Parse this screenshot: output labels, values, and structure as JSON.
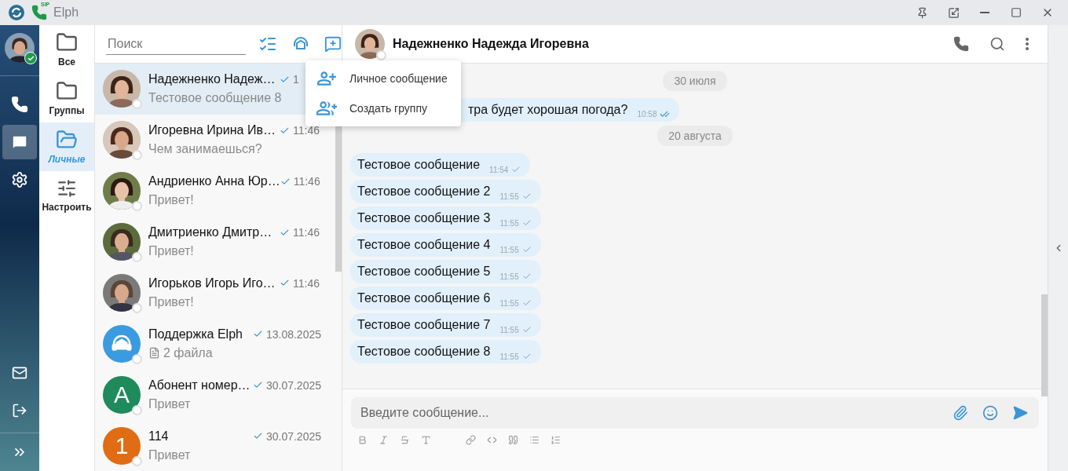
{
  "titlebar": {
    "app_name": "Elph",
    "sip_badge": "SIP"
  },
  "rail": {
    "user_online": true,
    "items": [
      {
        "kind": "phone",
        "selected": false
      },
      {
        "kind": "chat",
        "selected": true
      },
      {
        "kind": "settings",
        "selected": false
      }
    ],
    "bottom": [
      {
        "kind": "mail"
      },
      {
        "kind": "logout"
      },
      {
        "kind": "expand"
      }
    ]
  },
  "folders": [
    {
      "kind": "folder",
      "label": "Все",
      "selected": false
    },
    {
      "kind": "folder",
      "label": "Группы",
      "selected": false
    },
    {
      "kind": "folder",
      "label": "Личные",
      "selected": true
    },
    {
      "kind": "settings",
      "label": "Настроить",
      "selected": false
    }
  ],
  "search": {
    "placeholder": "Поиск"
  },
  "new_chat_menu": [
    {
      "kind": "person",
      "label": "Личное сообщение"
    },
    {
      "kind": "group",
      "label": "Создать группу"
    }
  ],
  "chats": [
    {
      "name": "Надежненко Надеж…",
      "time": "1",
      "preview": "Тестовое сообщение 8",
      "attachment": false,
      "selected": true
    },
    {
      "name": "Игоревна Ирина Ив…",
      "time": "11:46",
      "preview": "Чем занимаешься?",
      "attachment": false,
      "selected": false
    },
    {
      "name": "Андриенко Анна Юр…",
      "time": "11:46",
      "preview": "Привет!",
      "attachment": false,
      "selected": false
    },
    {
      "name": "Дмитриенко Дмитр…",
      "time": "11:46",
      "preview": "Привет!",
      "attachment": false,
      "selected": false
    },
    {
      "name": "Игорьков Игорь Иго…",
      "time": "11:46",
      "preview": "Привет!",
      "attachment": false,
      "selected": false
    },
    {
      "kind": "support",
      "name": "Поддержка Elph",
      "time": "13.08.2025",
      "preview": "2 файла",
      "attachment": true,
      "selected": false
    },
    {
      "kind": "letter",
      "letter": "A",
      "color": "#1f8a5b",
      "name": "Абонент номер…",
      "time": "30.07.2025",
      "preview": "Привет",
      "attachment": false,
      "selected": false
    },
    {
      "kind": "letter",
      "letter": "1",
      "color": "#e06c14",
      "name": "114",
      "time": "30.07.2025",
      "preview": "Привет",
      "attachment": false,
      "selected": false
    }
  ],
  "conversation": {
    "title": "Надежненко Надежда Игоревна",
    "messages": [
      {
        "kind": "date",
        "text": "30 июля"
      },
      {
        "kind": "message",
        "text": "тра будет хорошая погода?",
        "time": "10:58",
        "read": true,
        "partly_covered": true
      },
      {
        "kind": "date",
        "text": "20 августа"
      },
      {
        "kind": "message",
        "text": "Тестовое сообщение",
        "time": "11:54",
        "read": false
      },
      {
        "kind": "message",
        "text": "Тестовое сообщение 2",
        "time": "11:55",
        "read": false
      },
      {
        "kind": "message",
        "text": "Тестовое сообщение 3",
        "time": "11:55",
        "read": false
      },
      {
        "kind": "message",
        "text": "Тестовое сообщение 4",
        "time": "11:55",
        "read": false
      },
      {
        "kind": "message",
        "text": "Тестовое сообщение 5",
        "time": "11:55",
        "read": false
      },
      {
        "kind": "message",
        "text": "Тестовое сообщение 6",
        "time": "11:55",
        "read": false
      },
      {
        "kind": "message",
        "text": "Тестовое сообщение 7",
        "time": "11:55",
        "read": false
      },
      {
        "kind": "message",
        "text": "Тестовое сообщение 8",
        "time": "11:55",
        "read": false
      }
    ]
  },
  "composer": {
    "placeholder": "Введите сообщение..."
  }
}
